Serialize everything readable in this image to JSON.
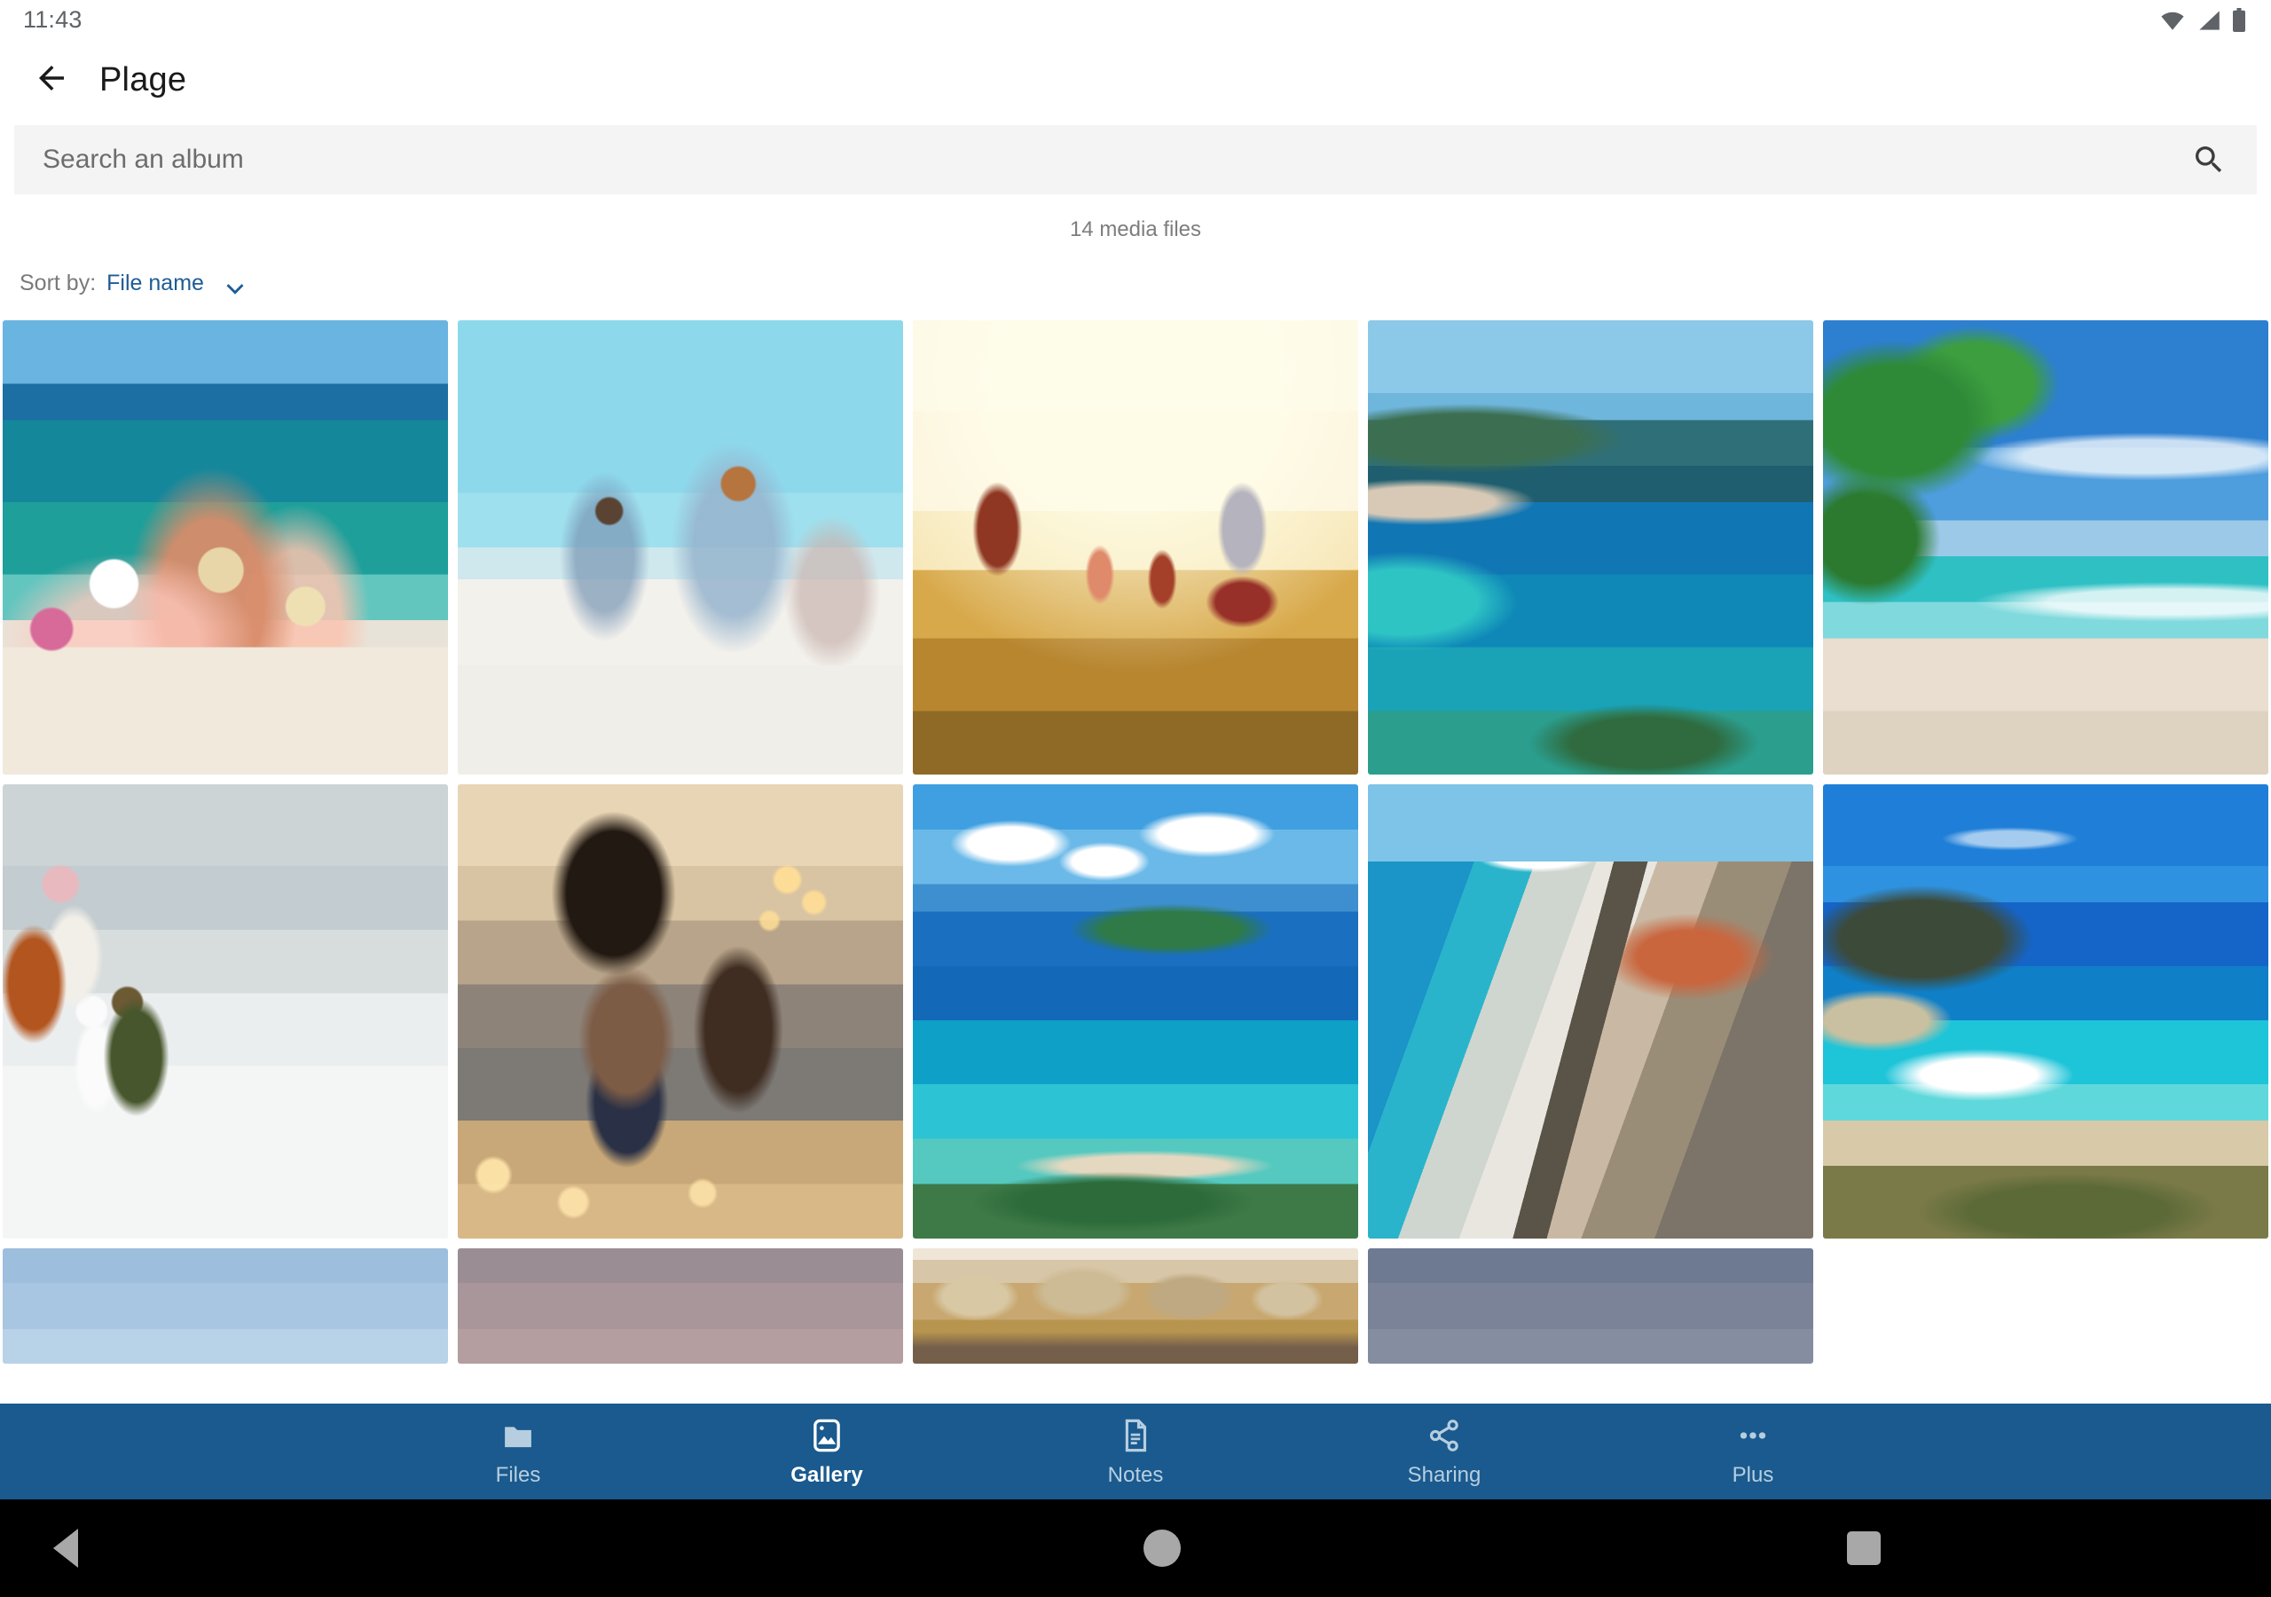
{
  "statusbar": {
    "clock": "11:43",
    "icons": [
      "wifi-icon",
      "cellular-signal-icon",
      "battery-icon"
    ]
  },
  "appbar": {
    "back_icon": "arrow-left-icon",
    "title": "Plage"
  },
  "search": {
    "placeholder": "Search an album",
    "value": "",
    "icon": "search-icon"
  },
  "meta": {
    "media_count": "14 media files"
  },
  "sort": {
    "label": "Sort by:",
    "value": "File name",
    "direction_icon": "arrow-down-icon",
    "accent_color": "#1d5c96"
  },
  "grid": {
    "columns": 5,
    "tiles": [
      {
        "name": "photo-family-beach-arms-raised",
        "art": "ph-beachfamily"
      },
      {
        "name": "photo-family-running-white-sand",
        "art": "ph-runbeach"
      },
      {
        "name": "photo-family-wheat-field-sunset",
        "art": "ph-wheat"
      },
      {
        "name": "photo-mediterranean-bay-aerial",
        "art": "ph-bay"
      },
      {
        "name": "photo-tropical-palm-beach",
        "art": "ph-palm"
      },
      {
        "name": "photo-family-snowman-winter",
        "art": "ph-snow"
      },
      {
        "name": "photo-mother-daughter-tent-lights",
        "art": "ph-tent"
      },
      {
        "name": "photo-tropical-bay-clouds",
        "art": "ph-tropicbay"
      },
      {
        "name": "photo-nice-promenade-aerial",
        "art": "ph-nice"
      },
      {
        "name": "photo-balos-lagoon",
        "art": "ph-balos"
      }
    ],
    "partial_tiles": [
      {
        "name": "photo-sky-blue-partial",
        "art": "ph-skyblue"
      },
      {
        "name": "photo-mauve-sky-partial",
        "art": "ph-mauve"
      },
      {
        "name": "photo-desert-dunes-partial",
        "art": "ph-dunes"
      },
      {
        "name": "photo-dusk-partial",
        "art": "ph-dusk"
      }
    ]
  },
  "bottomnav": {
    "background_color": "#1a5a8e",
    "active_color": "#ffffff",
    "inactive_color": "#b6cee0",
    "items": [
      {
        "label": "Files",
        "icon": "folder-icon",
        "active": false
      },
      {
        "label": "Gallery",
        "icon": "image-icon",
        "active": true
      },
      {
        "label": "Notes",
        "icon": "note-icon",
        "active": false
      },
      {
        "label": "Sharing",
        "icon": "share-icon",
        "active": false
      },
      {
        "label": "Plus",
        "icon": "more-dots-icon",
        "active": false
      }
    ]
  },
  "sysnav": {
    "back_icon": "triangle-back-icon",
    "home_icon": "circle-home-icon",
    "recents_icon": "square-recents-icon"
  }
}
